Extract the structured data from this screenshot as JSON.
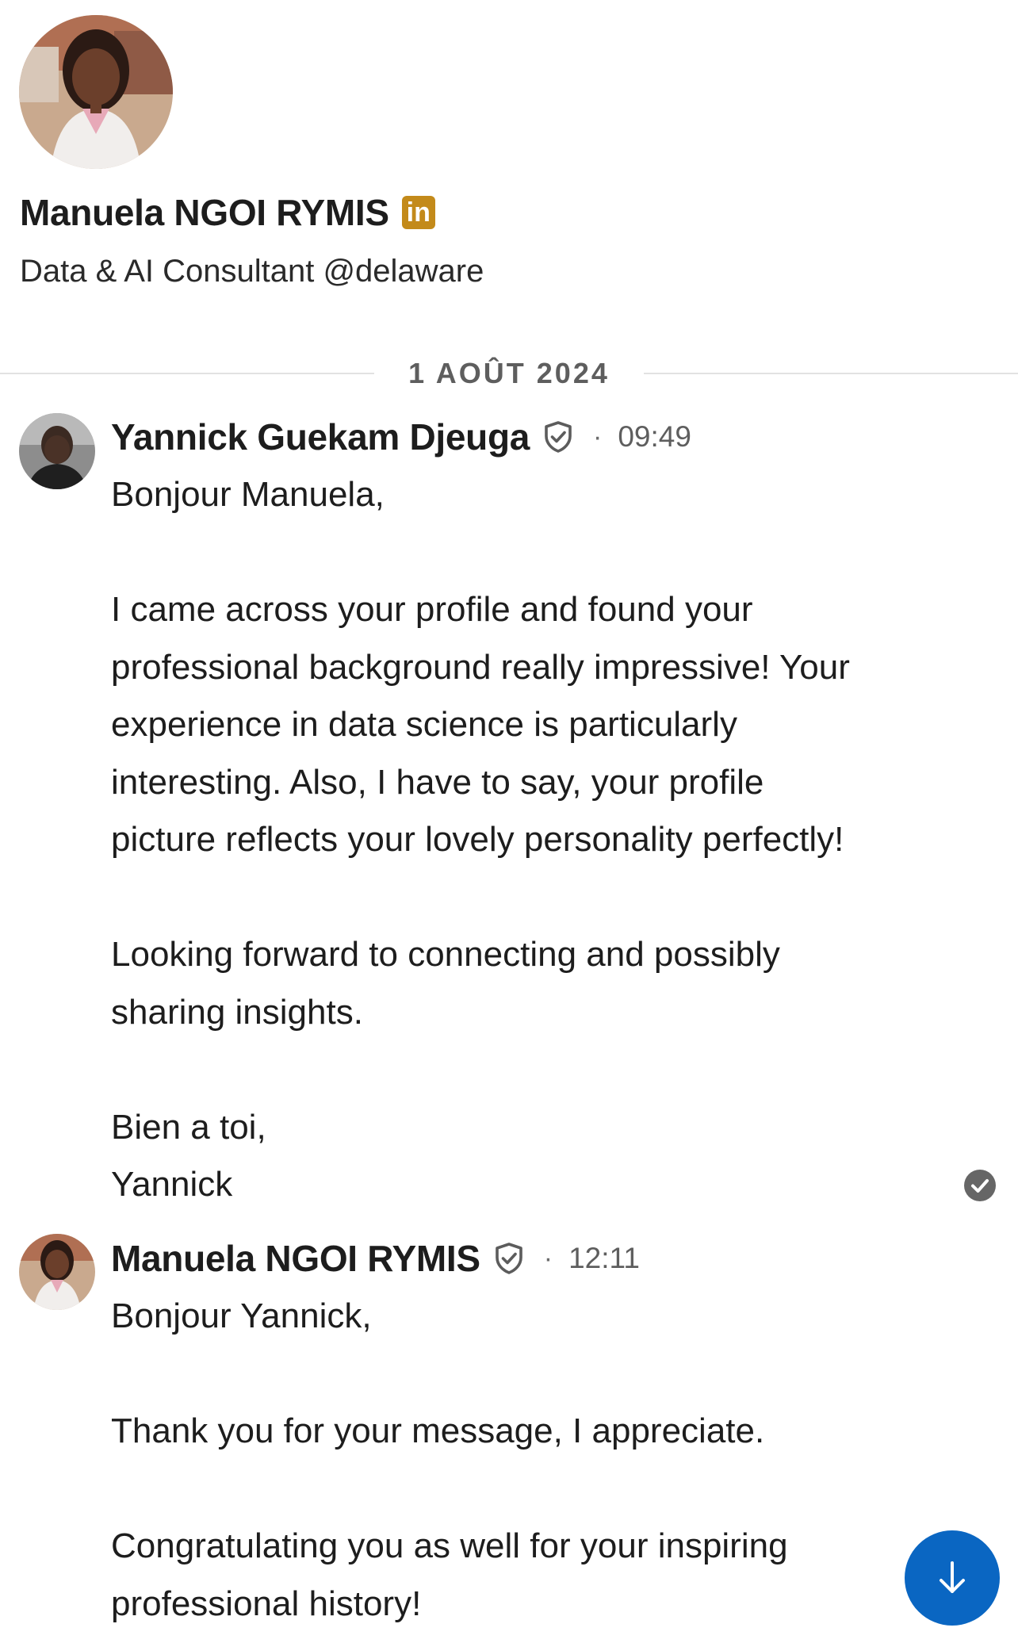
{
  "profile": {
    "name": "Manuela NGOI RYMIS",
    "linkedin_badge": "in",
    "headline": "Data & AI Consultant @delaware"
  },
  "date_divider": "1 AOÛT 2024",
  "messages": [
    {
      "sender": "Yannick Guekam Djeuga",
      "separator": "·",
      "time": "09:49",
      "paragraphs": [
        "Bonjour Manuela,",
        "I came across your profile and found your\nprofessional background really impressive! Your\nexperience in data science is particularly\ninteresting. Also, I have to say, your profile\npicture reflects your lovely personality perfectly!",
        "Looking forward to connecting and possibly\nsharing insights.",
        "Bien a toi,\nYannick"
      ]
    },
    {
      "sender": "Manuela NGOI RYMIS",
      "separator": "·",
      "time": "12:11",
      "paragraphs": [
        "Bonjour Yannick,",
        "Thank you for your message, I appreciate.",
        "Congratulating you as well for your inspiring\nprofessional history!"
      ]
    }
  ],
  "icons": {
    "verified": "verified-shield-icon",
    "read_receipt": "check-circle-icon",
    "scroll_down": "arrow-down-icon"
  },
  "colors": {
    "linkedin_badge": "#c38a1a",
    "fab": "#0a66c2",
    "divider": "#e2e2e2",
    "read_receipt": "#666666"
  }
}
